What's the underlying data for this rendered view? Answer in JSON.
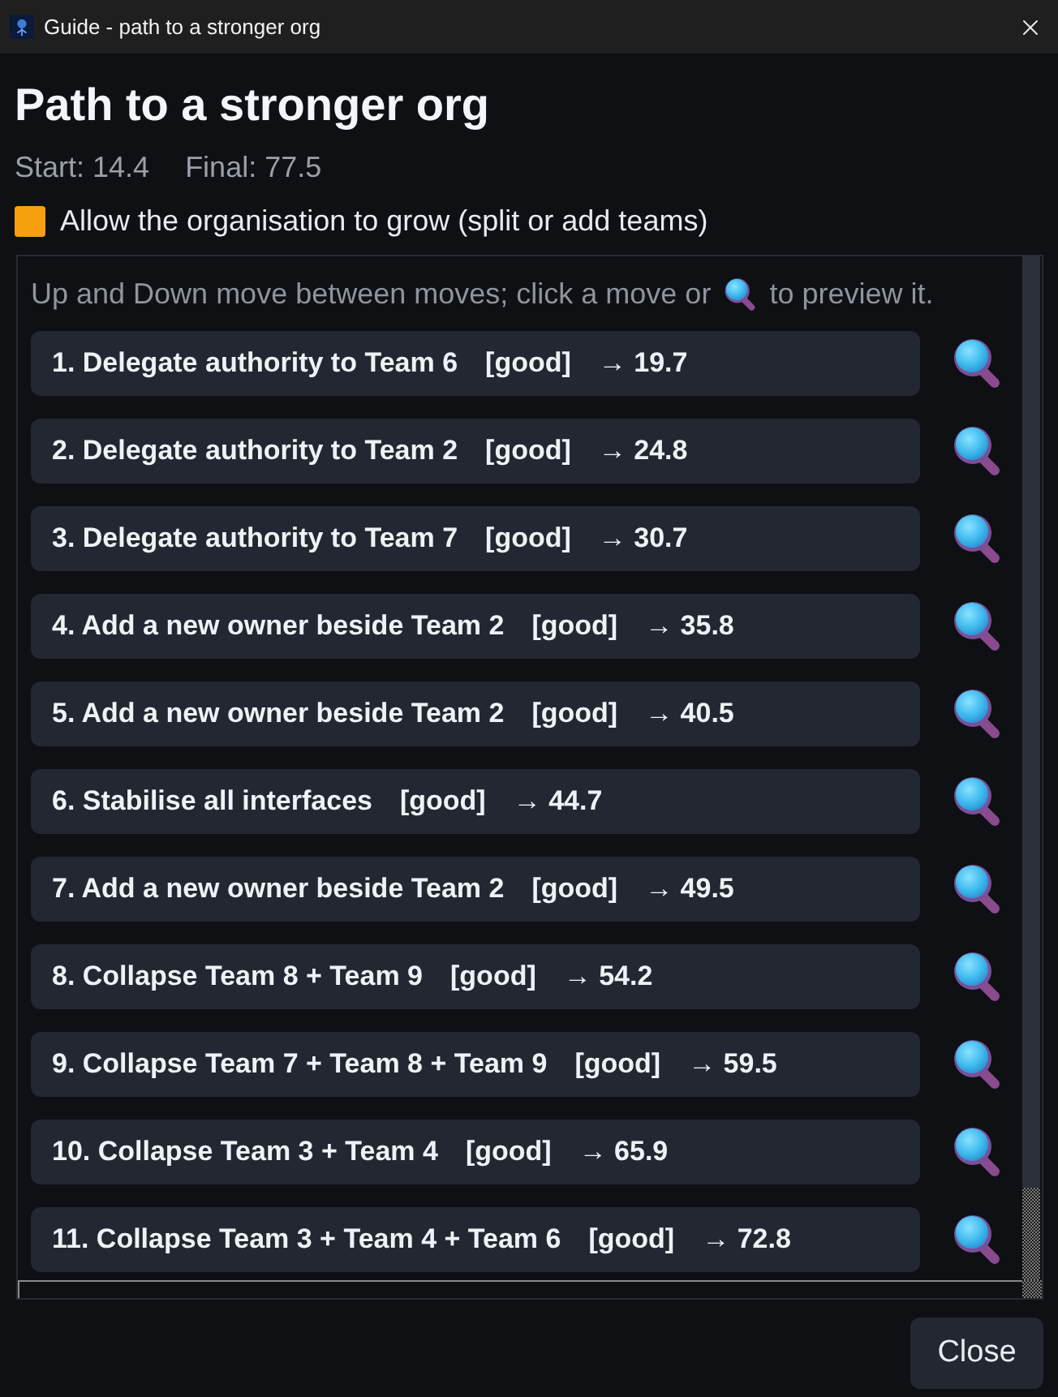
{
  "window": {
    "title": "Guide - path to a stronger org"
  },
  "heading": "Path to a stronger org",
  "stats": [
    "Start: 14.4",
    "Final: 77.5"
  ],
  "grow_option": {
    "label": "Allow the organisation to grow (split or add teams)",
    "checked": true
  },
  "hint": {
    "before": "Up and Down move between moves; click a move or",
    "after": "to preview it."
  },
  "moves": [
    {
      "label": "1. Delegate authority to Team 6",
      "tag": "[good]",
      "result": "→ 19.7"
    },
    {
      "label": "2. Delegate authority to Team 2",
      "tag": "[good]",
      "result": "→ 24.8"
    },
    {
      "label": "3. Delegate authority to Team 7",
      "tag": "[good]",
      "result": "→ 30.7"
    },
    {
      "label": "4. Add a new owner beside Team 2",
      "tag": "[good]",
      "result": "→ 35.8"
    },
    {
      "label": "5. Add a new owner beside Team 2",
      "tag": "[good]",
      "result": "→ 40.5"
    },
    {
      "label": "6. Stabilise all interfaces",
      "tag": "[good]",
      "result": "→ 44.7"
    },
    {
      "label": "7. Add a new owner beside Team 2",
      "tag": "[good]",
      "result": "→ 49.5"
    },
    {
      "label": "8. Collapse Team 8 + Team 9",
      "tag": "[good]",
      "result": "→ 54.2"
    },
    {
      "label": "9. Collapse Team 7 + Team 8 + Team 9",
      "tag": "[good]",
      "result": "→ 59.5"
    },
    {
      "label": "10. Collapse Team 3 + Team 4",
      "tag": "[good]",
      "result": "→ 65.9"
    },
    {
      "label": "11. Collapse Team 3 + Team 4 + Team 6",
      "tag": "[good]",
      "result": "→ 72.8"
    }
  ],
  "buttons": [
    "Close"
  ]
}
